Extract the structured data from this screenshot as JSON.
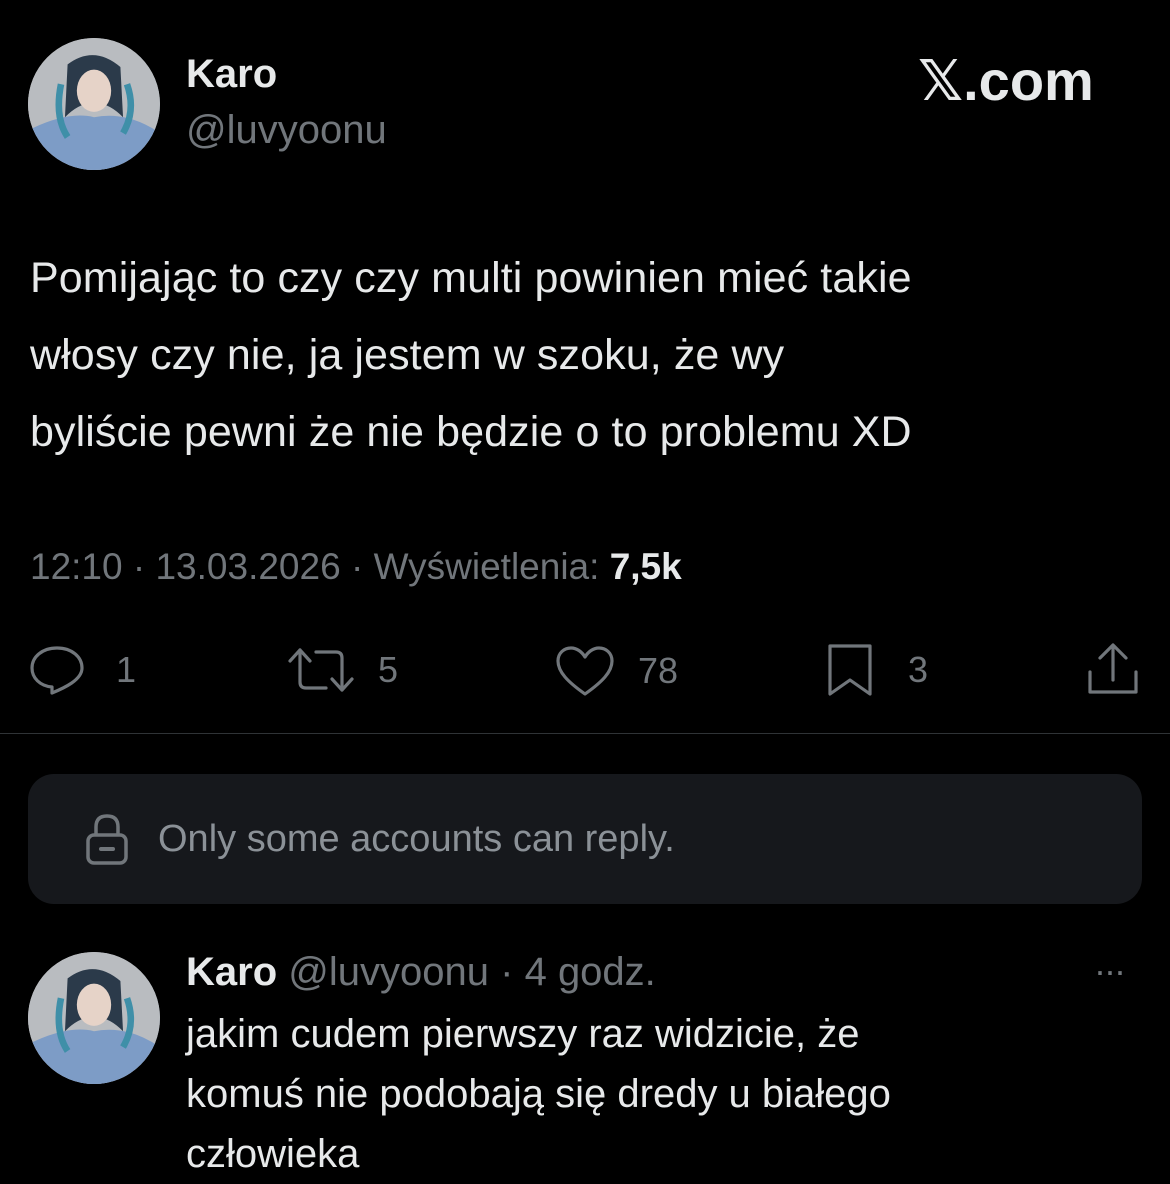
{
  "header": {
    "name": "Karo",
    "handle": "@luvyoonu",
    "brand": "𝕏.com"
  },
  "tweet": {
    "lines": [
      "Pomijając to czy czy multi powinien mieć takie",
      "włosy czy nie, ja jestem w szoku, że wy",
      "byliście pewni że nie będzie o to problemu XD"
    ],
    "time": "12:10",
    "date": "13.03.2026",
    "views_label": "Wyświetlenia:",
    "views_value": "7,5k",
    "separator": "·"
  },
  "actions": {
    "replies": "1",
    "reposts": "5",
    "likes": "78",
    "bookmarks": "3"
  },
  "reply_restriction": {
    "text": "Only some accounts can reply."
  },
  "reply": {
    "name": "Karo",
    "handle": "@luvyoonu",
    "separator": "·",
    "time": "4 godz.",
    "more": "···",
    "lines": [
      "jakim cudem pierwszy raz widzicie, że",
      "komuś nie podobają się dredy u białego",
      "człowieka"
    ]
  }
}
